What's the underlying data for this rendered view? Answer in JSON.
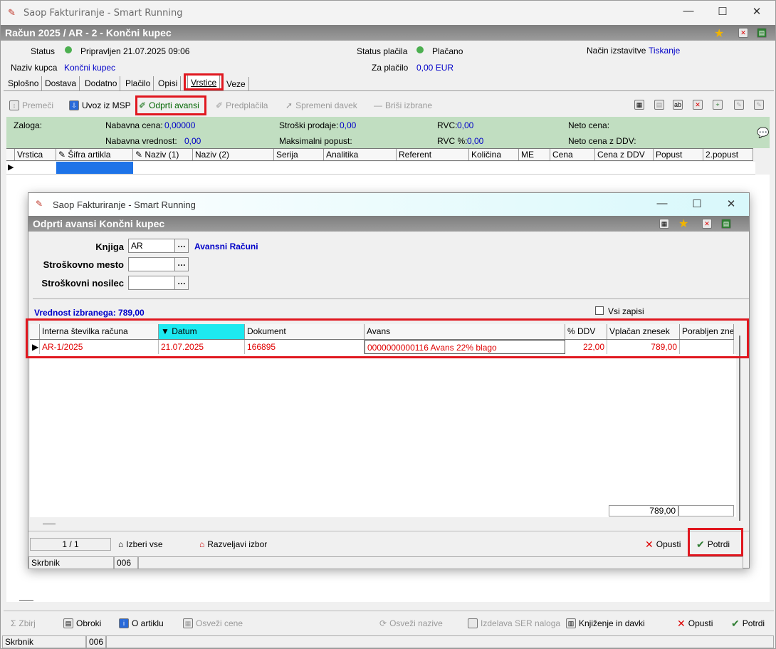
{
  "window": {
    "title": "Saop Fakturiranje - Smart Running"
  },
  "header": {
    "title": "Račun  2025 / AR - 2 - Končni kupec"
  },
  "info": {
    "status_label": "Status",
    "status_value": "Pripravljen 21.07.2025 09:06",
    "payment_status_label": "Status plačila",
    "payment_status_value": "Plačano",
    "issue_method_label": "Način izstavitve",
    "issue_method_value": "Tiskanje",
    "customer_label": "Naziv kupca",
    "customer_value": "Končni kupec",
    "to_pay_label": "Za plačilo",
    "to_pay_value": "0,00 EUR"
  },
  "tabs": [
    "Splošno",
    "Dostava",
    "Dodatno",
    "Plačilo",
    "Opisi",
    "Vrstice",
    "Veze"
  ],
  "toolbar": {
    "premeci": "Premeči",
    "uvoz": "Uvoz iz MSP",
    "odprti_avansi": "Odprti avansi",
    "predplacila": "Predplačila",
    "spremeni_davek": "Spremeni davek",
    "brisi": "Briši izbrane"
  },
  "summary": {
    "zaloga": "Zaloga:",
    "nab_cena_label": "Nabavna cena:",
    "nab_cena_value": "0,00000",
    "nab_vred_label": "Nabavna vrednost:",
    "nab_vred_value": "0,00",
    "stroski_label": "Stroški prodaje:",
    "stroski_value": "0,00",
    "max_popust_label": "Maksimalni popust:",
    "rvc_label": "RVC:",
    "rvc_value": "0,00",
    "rvcp_label": "RVC %:",
    "rvcp_value": "0,00",
    "neto_label": "Neto cena:",
    "neto_ddv_label": "Neto cena z DDV:"
  },
  "grid_columns": [
    "Vrstica",
    "Šifra artikla",
    "Naziv (1)",
    "Naziv (2)",
    "Serija",
    "Analitika",
    "Referent",
    "Količina",
    "ME",
    "Cena",
    "Cena z DDV",
    "Popust",
    "2.popust"
  ],
  "dialog": {
    "title": "Saop Fakturiranje - Smart Running",
    "header": "Odprti avansi Končni kupec",
    "knjiga_label": "Knjiga",
    "knjiga_value": "AR",
    "knjiga_desc": "Avansni Računi",
    "strosk_mesto_label": "Stroškovno mesto",
    "strosk_nosilec_label": "Stroškovni  nosilec",
    "vrednost": "Vrednost izbranega: 789,00",
    "vsi_zapisi": "Vsi zapisi",
    "columns": [
      "Interna številka računa",
      "Datum",
      "Dokument",
      "Avans",
      "% DDV",
      "Vplačan znesek",
      "Porabljen znes"
    ],
    "row": [
      "AR-1/2025",
      "21.07.2025",
      "166895",
      "0000000000116 Avans 22% blago",
      "22,00",
      "789,00",
      ""
    ],
    "total": "789,00",
    "pager": "1 / 1",
    "izberi_vse": "Izberi vse",
    "razveljavi": "Razveljavi izbor",
    "opusti": "Opusti",
    "potrdi": "Potrdi",
    "status_user": "Skrbnik",
    "status_code": "006"
  },
  "bottom": {
    "zbirj": "Zbirj",
    "obroki": "Obroki",
    "o_artiklu": "O artiklu",
    "osvezi_cene": "Osveži cene",
    "osvezi_nazive": "Osveži nazive",
    "izdelava": "Izdelava SER naloga",
    "knjizenje": "Knjiženje in davki",
    "opusti": "Opusti",
    "potrdi": "Potrdi",
    "status_user": "Skrbnik",
    "status_code": "006"
  },
  "colors": {
    "highlight": "#e0171f",
    "header": "#8c8c8c",
    "summary": "#c1dec1"
  }
}
